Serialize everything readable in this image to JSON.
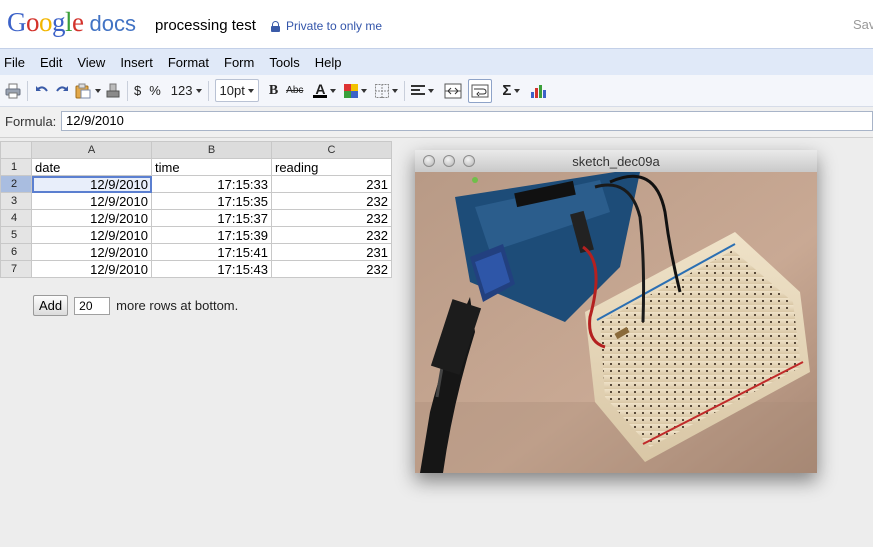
{
  "header": {
    "logo_letters": [
      "G",
      "o",
      "o",
      "g",
      "l",
      "e"
    ],
    "logo_colors": [
      "#3c62c8",
      "#d3322b",
      "#f2b600",
      "#3c62c8",
      "#3a9f3a",
      "#d3322b"
    ],
    "logo_suffix": "docs",
    "doc_title": "processing test",
    "privacy": "Private to only me",
    "save_link": "Sav"
  },
  "menu": [
    "File",
    "Edit",
    "View",
    "Insert",
    "Format",
    "Form",
    "Tools",
    "Help"
  ],
  "toolbar": {
    "currency": "$",
    "percent": "%",
    "number_format": "123",
    "font_size": "10pt",
    "bold": "B",
    "strike": "Abc",
    "text_color_letter": "A",
    "text_color": "#000000"
  },
  "formula": {
    "label": "Formula:",
    "value": "12/9/2010"
  },
  "sheet": {
    "columns": [
      "A",
      "B",
      "C"
    ],
    "rows": [
      {
        "num": "1",
        "date": "date",
        "time": "time",
        "reading": "reading"
      },
      {
        "num": "2",
        "date": "12/9/2010",
        "time": "17:15:33",
        "reading": "231"
      },
      {
        "num": "3",
        "date": "12/9/2010",
        "time": "17:15:35",
        "reading": "232"
      },
      {
        "num": "4",
        "date": "12/9/2010",
        "time": "17:15:37",
        "reading": "232"
      },
      {
        "num": "5",
        "date": "12/9/2010",
        "time": "17:15:39",
        "reading": "232"
      },
      {
        "num": "6",
        "date": "12/9/2010",
        "time": "17:15:41",
        "reading": "231"
      },
      {
        "num": "7",
        "date": "12/9/2010",
        "time": "17:15:43",
        "reading": "232"
      }
    ],
    "add_button": "Add",
    "add_rows_value": "20",
    "add_rows_text": "more rows at bottom."
  },
  "sketch_window": {
    "title": "sketch_dec09a"
  }
}
